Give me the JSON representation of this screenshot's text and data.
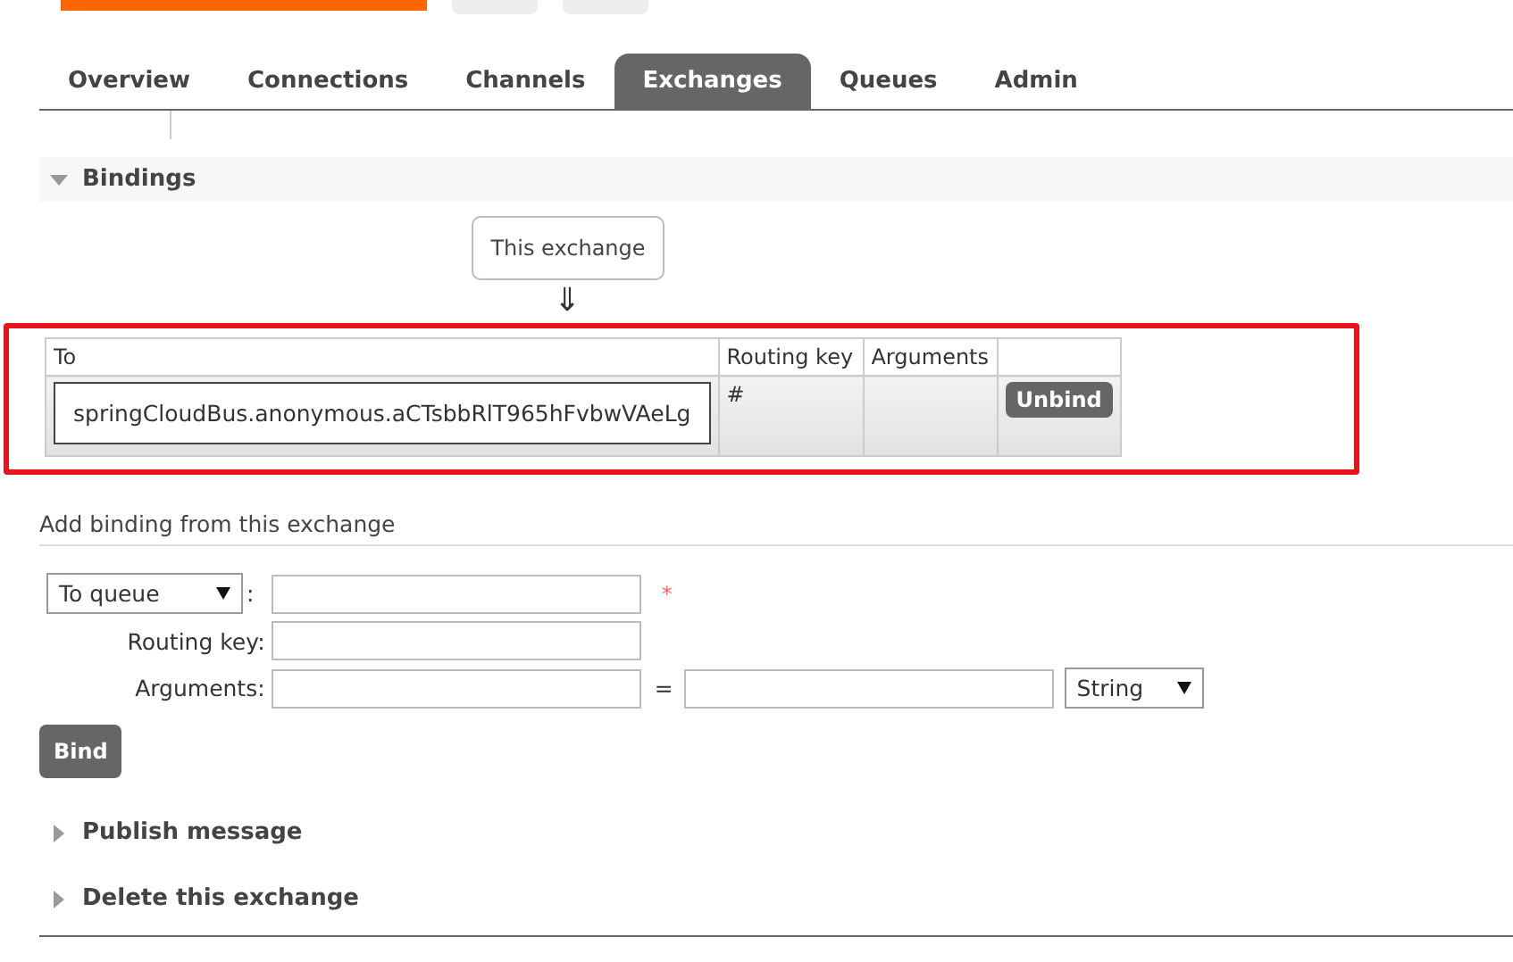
{
  "tabs": [
    {
      "label": "Overview",
      "selected": false
    },
    {
      "label": "Connections",
      "selected": false
    },
    {
      "label": "Channels",
      "selected": false
    },
    {
      "label": "Exchanges",
      "selected": true
    },
    {
      "label": "Queues",
      "selected": false
    },
    {
      "label": "Admin",
      "selected": false
    }
  ],
  "bindings": {
    "title": "Bindings",
    "expanded": true,
    "source": "This exchange",
    "arrow": "⇓",
    "highlighted": true,
    "columns": [
      "To",
      "Routing key",
      "Arguments"
    ],
    "rows": [
      {
        "to": "springCloudBus.anonymous.aCTsbbRlT965hFvbwVAeLg",
        "routing_key": "#",
        "action": "Unbind"
      }
    ]
  },
  "add_binding": {
    "heading": "Add binding from this exchange",
    "destination_type": "To queue",
    "colon": ":",
    "required_mark": "*",
    "routing_key_label": "Routing key:",
    "arguments_label": "Arguments:",
    "equals": "=",
    "argument_type": "String",
    "button": "Bind"
  },
  "sections": [
    {
      "title": "Publish message",
      "expanded": false
    },
    {
      "title": "Delete this exchange",
      "expanded": false
    }
  ]
}
